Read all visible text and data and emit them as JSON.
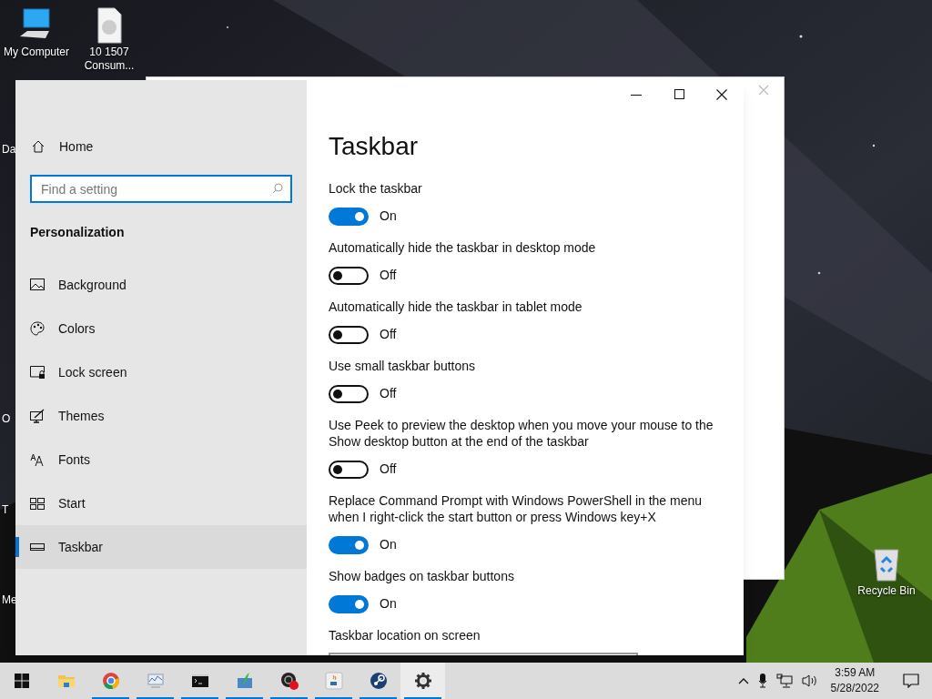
{
  "desktop": {
    "icons": [
      {
        "kind": "computer",
        "label": "My Computer"
      },
      {
        "kind": "file",
        "label": "10 1507 Consum..."
      },
      {
        "kind": "recycle",
        "label": "Recycle Bin"
      }
    ],
    "partial_labels": [
      "Da",
      "O",
      "T",
      "Me"
    ]
  },
  "settings": {
    "sidebar": {
      "home": "Home",
      "search": {
        "placeholder": "Find a setting"
      },
      "section": "Personalization",
      "items": [
        {
          "label": "Background",
          "selected": false
        },
        {
          "kind": "palette",
          "label": "Colors",
          "selected": false
        },
        {
          "kind": "lock",
          "label": "Lock screen",
          "selected": false
        },
        {
          "kind": "themes",
          "label": "Themes",
          "selected": false
        },
        {
          "kind": "fonts",
          "label": "Fonts",
          "selected": false
        },
        {
          "kind": "start",
          "label": "Start",
          "selected": false
        },
        {
          "kind": "taskbar",
          "label": "Taskbar",
          "selected": true
        }
      ]
    },
    "page": {
      "title": "Taskbar",
      "settings": [
        {
          "label": "Lock the taskbar",
          "on": true,
          "state_text": "On"
        },
        {
          "label": "Automatically hide the taskbar in desktop mode",
          "on": false,
          "state_text": "Off"
        },
        {
          "label": "Automatically hide the taskbar in tablet mode",
          "on": false,
          "state_text": "Off"
        },
        {
          "label": "Use small taskbar buttons",
          "on": false,
          "state_text": "Off"
        },
        {
          "label": "Use Peek to preview the desktop when you move your mouse to the Show desktop button at the end of the taskbar",
          "on": false,
          "state_text": "Off"
        },
        {
          "label": "Replace Command Prompt with Windows PowerShell in the menu when I right-click the start button or press Windows key+X",
          "on": true,
          "state_text": "On"
        },
        {
          "label": "Show badges on taskbar buttons",
          "on": true,
          "state_text": "On"
        }
      ],
      "location_label": "Taskbar location on screen"
    }
  },
  "taskbar": {
    "apps": [
      {
        "kind": "folder",
        "running": false,
        "active": false
      },
      {
        "kind": "chrome",
        "running": true,
        "active": false
      },
      {
        "kind": "monitor",
        "running": true,
        "active": false
      },
      {
        "kind": "terminal",
        "running": true,
        "active": false
      },
      {
        "kind": "green",
        "running": true,
        "active": false
      },
      {
        "kind": "recorder",
        "running": true,
        "active": false
      },
      {
        "kind": "java",
        "running": true,
        "active": false
      },
      {
        "kind": "steam",
        "running": true,
        "active": false
      },
      {
        "kind": "gear",
        "running": true,
        "active": true
      }
    ],
    "clock": {
      "time": "3:59 AM",
      "date": "5/28/2022"
    }
  }
}
